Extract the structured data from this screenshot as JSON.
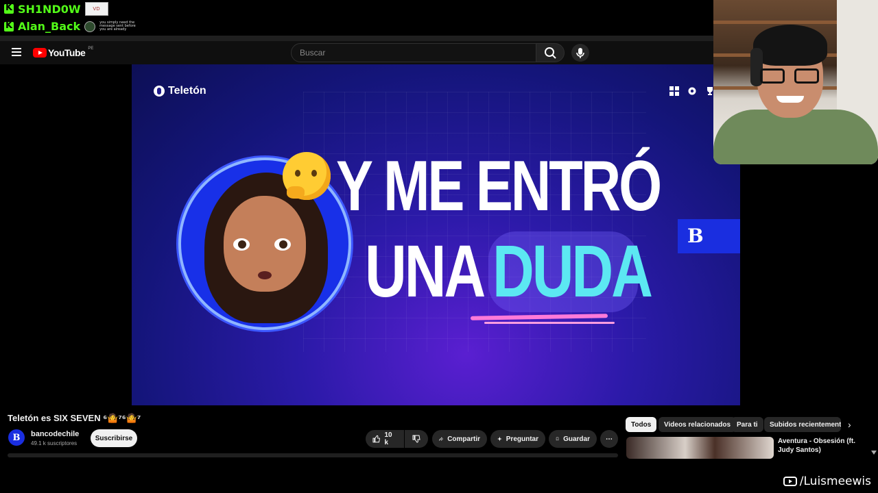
{
  "chat": {
    "messages": [
      {
        "username": "SH1ND0W",
        "attachment": "VD"
      },
      {
        "username": "Alan_Back",
        "attachment": "you simply need the message sent before you are already"
      }
    ]
  },
  "youtube": {
    "logo_text": "YouTube",
    "region": "PE",
    "search_placeholder": "Buscar"
  },
  "video": {
    "brand": "Teletón",
    "headline_line1": "Y ME ENTRÓ",
    "headline_line2_white": "UNA",
    "headline_line2_cyan": "DUDA",
    "title": "Teletón es SIX SEVEN ⁶🤷⁷⁶🤷⁷",
    "channel": {
      "avatar_letter": "B",
      "name": "bancodechile",
      "subscribers": "49.1 k suscriptores"
    },
    "subscribe_label": "Suscribirse",
    "actions": {
      "likes": "10 k",
      "share": "Compartir",
      "ask": "Preguntar",
      "save": "Guardar",
      "more": "⋯"
    }
  },
  "filters": {
    "chips": [
      "Todos",
      "Videos relacionados",
      "Para ti",
      "Subidos recientemente"
    ],
    "active": "Todos"
  },
  "recommendation": {
    "title": "Aventura - Obsesión (ft. Judy Santos)"
  },
  "watermark": "/Luismeewis",
  "colors": {
    "kick_green": "#53fc18",
    "yt_red": "#ff0000",
    "headline_cyan": "#5ce8f2",
    "bank_blue": "#1a2ee0"
  }
}
